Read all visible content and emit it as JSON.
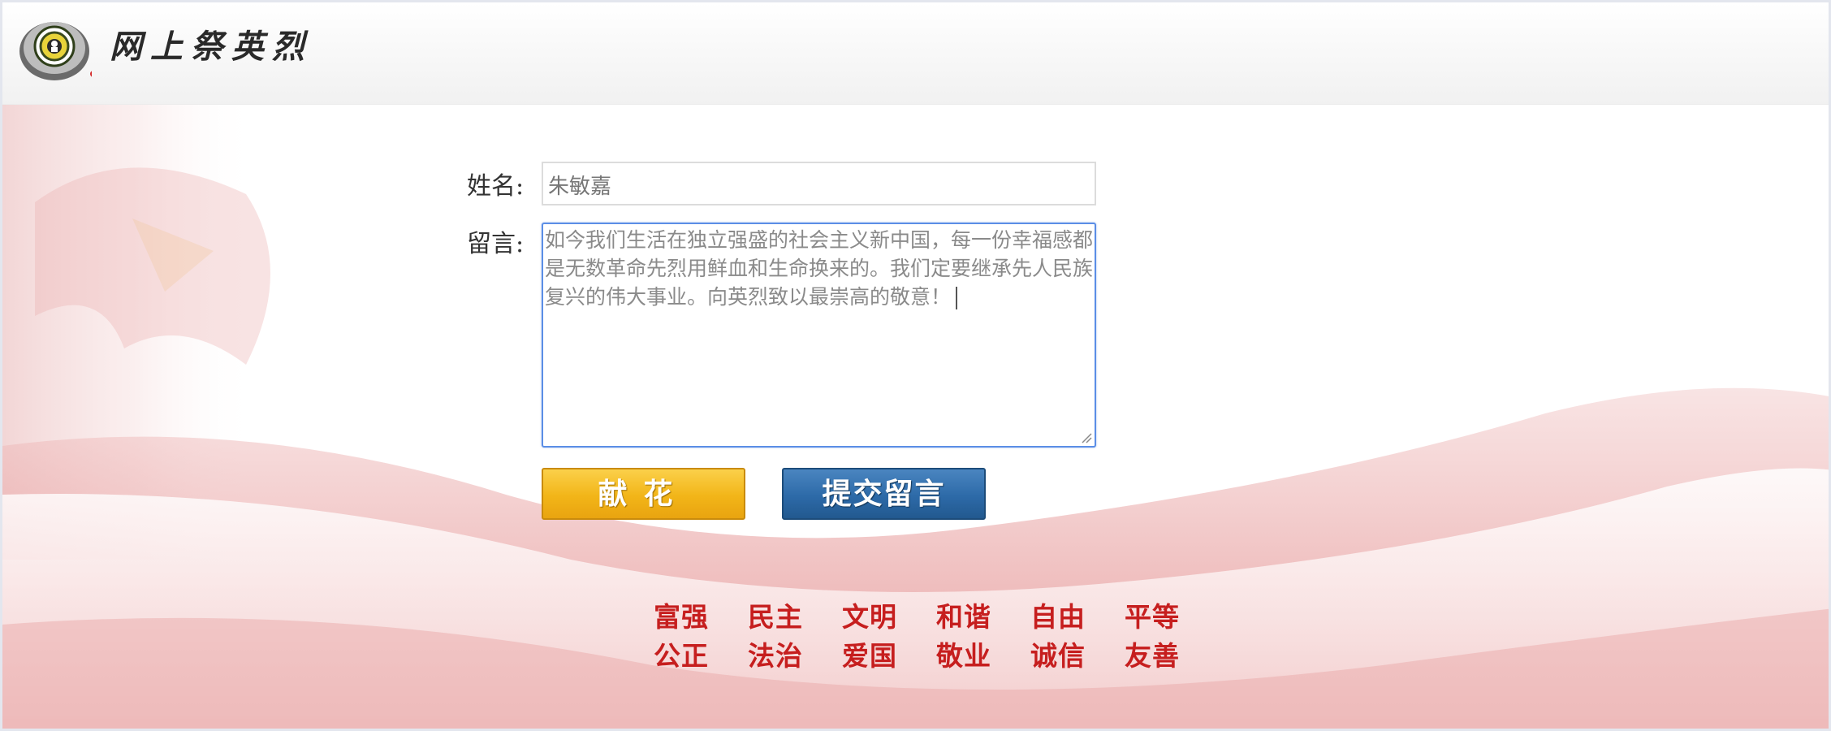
{
  "header": {
    "site_title": "网上祭英烈",
    "logo_icon": "memorial-emblem-icon"
  },
  "form": {
    "name_label": "姓名:",
    "name_value": "朱敏嘉",
    "message_label": "留言:",
    "message_value": "如今我们生活在独立强盛的社会主义新中国，每一份幸福感都是无数革命先烈用鲜血和生命换来的。我们定要继承先人民族复兴的伟大事业。向英烈致以最崇高的敬意！"
  },
  "buttons": {
    "flower_label": "献花",
    "submit_label": "提交留言"
  },
  "core_values": {
    "row1": [
      "富强",
      "民主",
      "文明",
      "和谐",
      "自由",
      "平等"
    ],
    "row2": [
      "公正",
      "法治",
      "爱国",
      "敬业",
      "诚信",
      "友善"
    ]
  },
  "colors": {
    "accent_red": "#c61e1e",
    "flower_button": "#f2b518",
    "submit_button": "#2d6aa8",
    "focus_border": "#5b8ee6"
  }
}
